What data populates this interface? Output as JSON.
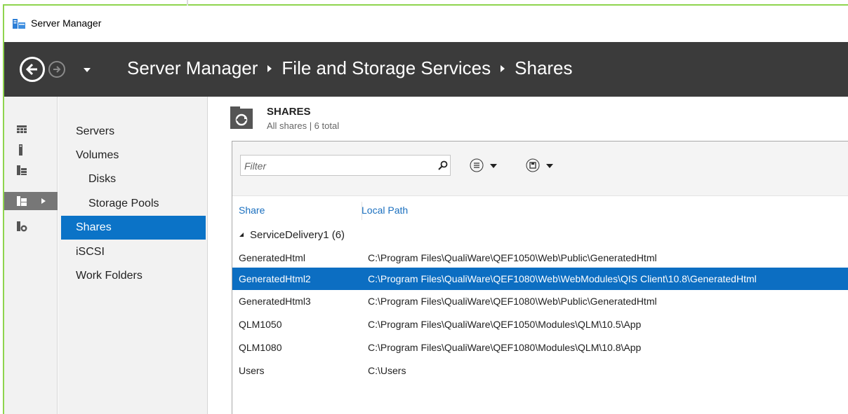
{
  "window": {
    "title": "Server Manager"
  },
  "breadcrumb": [
    "Server Manager",
    "File and Storage Services",
    "Shares"
  ],
  "nav": {
    "items": [
      {
        "label": "Servers"
      },
      {
        "label": "Volumes"
      },
      {
        "label": "Disks"
      },
      {
        "label": "Storage Pools"
      },
      {
        "label": "Shares",
        "selected": true
      },
      {
        "label": "iSCSI"
      },
      {
        "label": "Work Folders"
      }
    ]
  },
  "section": {
    "title": "SHARES",
    "subtitle": "All shares | 6 total"
  },
  "toolbar": {
    "filter_placeholder": "Filter"
  },
  "table": {
    "columns": [
      "Share",
      "Local Path"
    ],
    "group": {
      "name": "ServiceDelivery1",
      "count": "(6)"
    },
    "rows": [
      {
        "share": "GeneratedHtml",
        "path": "C:\\Program Files\\QualiWare\\QEF1050\\Web\\Public\\GeneratedHtml",
        "selected": false
      },
      {
        "share": "GeneratedHtml2",
        "path": "C:\\Program Files\\QualiWare\\QEF1080\\Web\\WebModules\\QIS Client\\10.8\\GeneratedHtml",
        "selected": true
      },
      {
        "share": "GeneratedHtml3",
        "path": "C:\\Program Files\\QualiWare\\QEF1080\\Web\\Public\\GeneratedHtml",
        "selected": false
      },
      {
        "share": "QLM1050",
        "path": "C:\\Program Files\\QualiWare\\QEF1050\\Modules\\QLM\\10.5\\App",
        "selected": false
      },
      {
        "share": "QLM1080",
        "path": "C:\\Program Files\\QualiWare\\QEF1080\\Modules\\QLM\\10.8\\App",
        "selected": false
      },
      {
        "share": "Users",
        "path": "C:\\Users",
        "selected": false
      }
    ]
  },
  "colors": {
    "header_bg": "#3b3b3b",
    "selection": "#0c6ec2",
    "nav_selection": "#0b73c7",
    "link": "#1a6fbf"
  },
  "icons": [
    "app-icon",
    "back-arrow-icon",
    "forward-arrow-icon",
    "dashboard-icon",
    "local-server-icon",
    "all-servers-icon",
    "file-storage-icon",
    "iis-icon",
    "shares-icon",
    "search-icon",
    "list-options-icon",
    "save-options-icon"
  ]
}
